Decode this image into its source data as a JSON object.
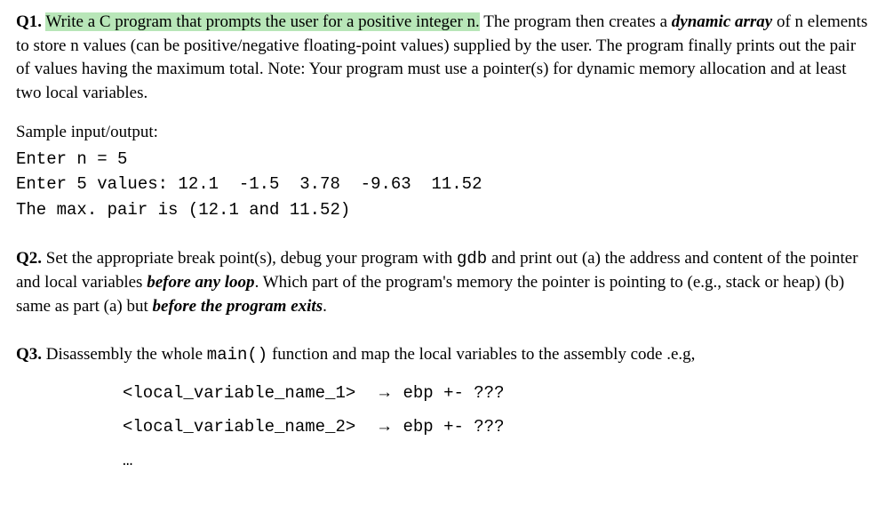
{
  "q1": {
    "label": "Q1.",
    "highlighted": "Write a C program that prompts the user for a positive integer n.",
    "rest1": " The program then creates a ",
    "dynamic_array": "dynamic array",
    "rest2": " of n elements to store n values (can be positive/negative floating-point values) supplied by the user. The program finally prints out the pair of values having the maximum total. Note: Your program must use a pointer(s) for dynamic memory allocation and at least two local variables.",
    "sample_label": "Sample input/output:",
    "sample_line1": "Enter n = 5",
    "sample_line2": "Enter 5 values: 12.1  -1.5  3.78  -9.63  11.52",
    "sample_line3": "The max. pair is (12.1 and 11.52)"
  },
  "q2": {
    "label": "Q2.",
    "text1": " Set the appropriate break point(s), debug your program with ",
    "gdb": "gdb",
    "text2": " and print out (a) the address and content of the pointer and local variables ",
    "before_any_loop": "before any loop",
    "text3": ". Which part of the program's memory the pointer is pointing to (e.g., stack or heap) (b) same as part (a) but ",
    "before_exits": "before the program exits",
    "text4": "."
  },
  "q3": {
    "label": "Q3.",
    "text1": " Disassembly the whole ",
    "main": "main()",
    "text2": "  function and map the local variables to the assembly code .e.g,",
    "var1": "<local_variable_name_1>",
    "var2": "<local_variable_name_2>",
    "arrow": "→",
    "reg": "ebp +- ???",
    "ellipsis": "…"
  }
}
